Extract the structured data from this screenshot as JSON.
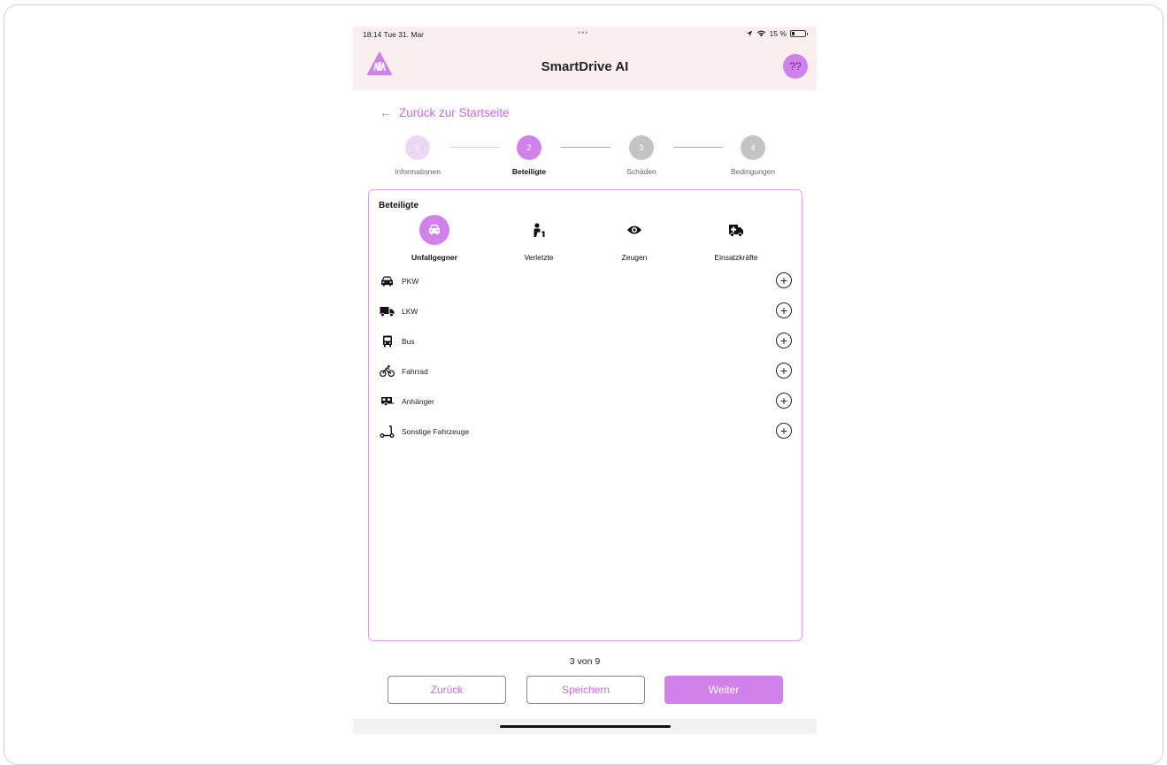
{
  "status_bar": {
    "time": "18:14",
    "date": "Tue 31. Mar",
    "dots": "•••",
    "battery": "15 %"
  },
  "header": {
    "title": "SmartDrive AI",
    "help_label": "??"
  },
  "back_link": {
    "label": "Zurück zur Startseite"
  },
  "stepper": {
    "steps": [
      {
        "number": "1",
        "label": "Informationen",
        "state": "done"
      },
      {
        "number": "2",
        "label": "Beteiligte",
        "state": "active"
      },
      {
        "number": "3",
        "label": "Schäden",
        "state": "pending"
      },
      {
        "number": "4",
        "label": "Bedingungen",
        "state": "pending"
      }
    ]
  },
  "card": {
    "title": "Beteiligte",
    "categories": [
      {
        "label": "Unfallgegner",
        "icon": "car-icon",
        "active": true
      },
      {
        "label": "Verletzte",
        "icon": "injured-person-icon",
        "active": false
      },
      {
        "label": "Zeugen",
        "icon": "eye-icon",
        "active": false
      },
      {
        "label": "Einsatzkräfte",
        "icon": "ambulance-icon",
        "active": false
      }
    ],
    "vehicles": [
      {
        "label": "PKW",
        "icon": "car-icon"
      },
      {
        "label": "LKW",
        "icon": "truck-icon"
      },
      {
        "label": "Bus",
        "icon": "bus-icon"
      },
      {
        "label": "Fahrrad",
        "icon": "bicycle-icon"
      },
      {
        "label": "Anhänger",
        "icon": "trailer-icon"
      },
      {
        "label": "Sonstige Fahrzeuge",
        "icon": "scooter-icon"
      }
    ],
    "add_symbol": "+"
  },
  "pagination": {
    "text": "3 von 9"
  },
  "footer": {
    "back_label": "Zurück",
    "save_label": "Speichern",
    "next_label": "Weiter"
  },
  "colors": {
    "accent": "#d081ea",
    "accent_text": "#c86be6",
    "header_bg": "#fbeeee",
    "step_done": "#ecd8f3",
    "step_pending": "#c4c4c4"
  }
}
